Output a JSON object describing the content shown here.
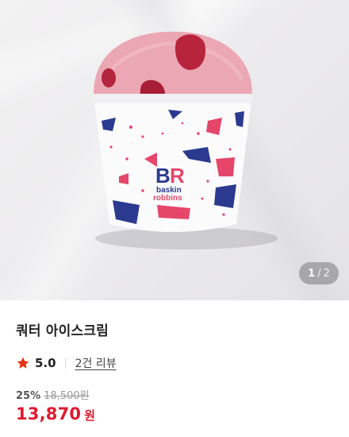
{
  "gallery": {
    "current": "1",
    "separator": "/",
    "total": "2",
    "logo_text": [
      "baskin",
      "robbins"
    ]
  },
  "product": {
    "name": "쿼터 아이스크림",
    "rating": "5.0",
    "review_link": "2건 리뷰",
    "discount_rate": "25%",
    "original_price": "18,500원",
    "sale_price": "13,870",
    "sale_unit": "원"
  },
  "colors": {
    "price_red": "#e0192e",
    "star_red": "#e63312",
    "brand_blue": "#2b3a8f",
    "brand_pink": "#e5466a"
  }
}
